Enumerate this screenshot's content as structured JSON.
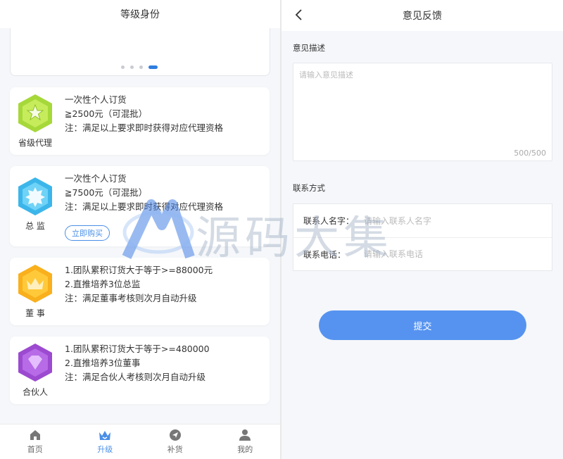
{
  "left": {
    "title": "等级身份",
    "levels": [
      {
        "name": "省级代理",
        "lines": [
          "一次性个人订货",
          "≧2500元（可混批）",
          "注：满足以上要求即时获得对应代理资格"
        ],
        "color": "#a6d83a"
      },
      {
        "name": "总 监",
        "lines": [
          "一次性个人订货",
          "≧7500元（可混批）",
          "注：满足以上要求即时获得对应代理资格"
        ],
        "button": "立即购买",
        "color": "#3cb6ea"
      },
      {
        "name": "董 事",
        "lines": [
          "1.团队累积订货大于等于>=88000元",
          "2.直推培养3位总监",
          "注：满足董事考核则次月自动升级"
        ],
        "color": "#f9b01c"
      },
      {
        "name": "合伙人",
        "lines": [
          "1.团队累积订货大于等于>=480000",
          "2.直推培养3位董事",
          "注：满足合伙人考核则次月自动升级"
        ],
        "color": "#9c4ad0"
      }
    ],
    "tabs": [
      {
        "label": "首页",
        "icon": "home-icon"
      },
      {
        "label": "升级",
        "icon": "crown-icon",
        "active": true
      },
      {
        "label": "补货",
        "icon": "navigation-icon"
      },
      {
        "label": "我的",
        "icon": "user-icon"
      }
    ]
  },
  "right": {
    "title": "意见反馈",
    "desc_label": "意见描述",
    "desc_placeholder": "请输入意见描述",
    "counter": "500/500",
    "contact_label": "联系方式",
    "name_label": "联系人名字：",
    "name_placeholder": "请输入联系人名字",
    "phone_label": "联系电话：",
    "phone_placeholder": "请输入联系电话",
    "submit": "提交"
  },
  "watermark": "源码大集",
  "colors": {
    "accent": "#4a8fe7",
    "submit": "#5693f0"
  }
}
